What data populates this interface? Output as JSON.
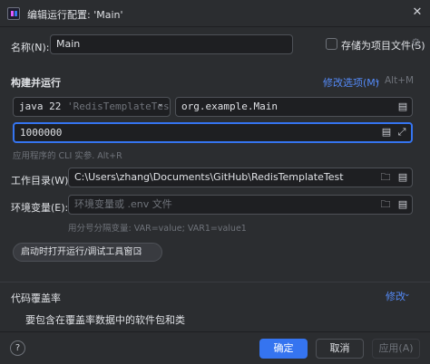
{
  "window": {
    "title": "编辑运行配置: 'Main'"
  },
  "name_row": {
    "label": "名称(N):",
    "value": "Main",
    "store_label": "存储为项目文件(S)"
  },
  "build": {
    "section_title": "构建并运行",
    "modify_options": "修改选项(M)",
    "modify_shortcut": "Alt+M",
    "jdk": "java 22",
    "jdk_module": "'RedisTemplateTest'",
    "main_class": "org.example.Main",
    "program_args": "1000000",
    "args_hint": "应用程序的 CLI 实参. Alt+R"
  },
  "working_dir": {
    "label": "工作目录(W):",
    "value": "C:\\Users\\zhang\\Documents\\GitHub\\RedisTemplateTest"
  },
  "env": {
    "label": "环境变量(E):",
    "placeholder": "环境变量或 .env 文件",
    "hint": "用分号分隔变量: VAR=value; VAR1=value1"
  },
  "chip": {
    "label": "启动时打开运行/调试工具窗口"
  },
  "coverage": {
    "section_title": "代码覆盖率",
    "modify": "修改",
    "description": "要包含在覆盖率数据中的软件包和类"
  },
  "footer": {
    "help": "?",
    "ok": "确定",
    "cancel": "取消",
    "apply": "应用(A)"
  },
  "colors": {
    "background": "#2b2d30",
    "field": "#1e1f22",
    "accent": "#3574f0",
    "link": "#548af7"
  }
}
